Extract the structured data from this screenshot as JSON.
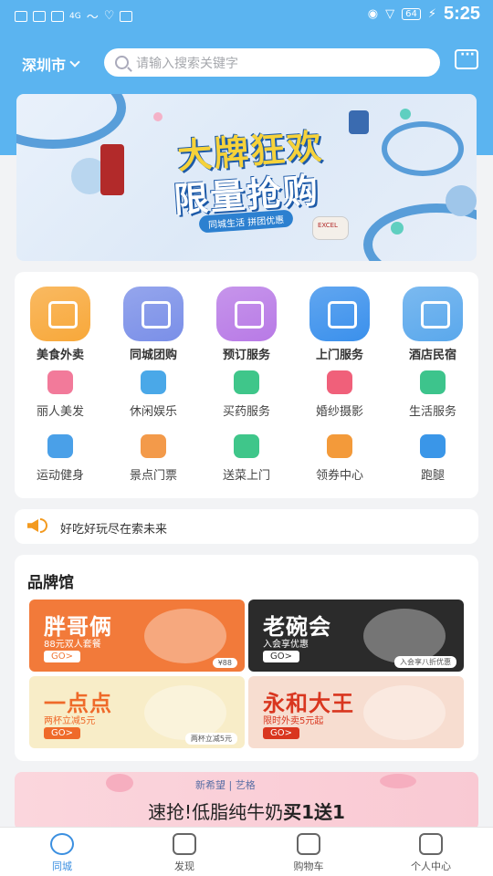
{
  "status_bar": {
    "time": "5:25",
    "battery": "64",
    "signal_label": "4G"
  },
  "header": {
    "city": "深圳市",
    "search_placeholder": "请输入搜索关键字",
    "message_icon": "message-icon"
  },
  "banner": {
    "title_line1": "大牌狂欢",
    "title_line2": "限量抢购",
    "subtitle": "同城生活 拼团优惠",
    "product_label": "EXCEL"
  },
  "services": {
    "primary": [
      {
        "label": "美食外卖",
        "icon": "food-icon",
        "color": "#f8a83a"
      },
      {
        "label": "同城团购",
        "icon": "basket-icon",
        "color": "#7a8fe8"
      },
      {
        "label": "预订服务",
        "icon": "calendar-icon",
        "color": "#b87ae6"
      },
      {
        "label": "上门服务",
        "icon": "door-icon",
        "color": "#3a90ec"
      },
      {
        "label": "酒店民宿",
        "icon": "hotel-icon",
        "color": "#5aa8ec"
      }
    ],
    "secondary": [
      {
        "label": "丽人美发",
        "icon": "beauty-icon",
        "color": "#f27a9a"
      },
      {
        "label": "休闲娱乐",
        "icon": "microphone-icon",
        "color": "#4aa8e8"
      },
      {
        "label": "买药服务",
        "icon": "medicine-icon",
        "color": "#3fc68a"
      },
      {
        "label": "婚纱摄影",
        "icon": "heart-camera-icon",
        "color": "#f0607a"
      },
      {
        "label": "生活服务",
        "icon": "house-icon",
        "color": "#3dc48c"
      },
      {
        "label": "运动健身",
        "icon": "dumbbell-icon",
        "color": "#4aa0e8"
      },
      {
        "label": "景点门票",
        "icon": "ticket-icon",
        "color": "#f39a4a"
      },
      {
        "label": "送菜上门",
        "icon": "delivery-truck-icon",
        "color": "#3fc68a"
      },
      {
        "label": "领券中心",
        "icon": "coupon-icon",
        "color": "#f39a3a"
      },
      {
        "label": "跑腿",
        "icon": "runner-icon",
        "color": "#3a96e8"
      }
    ]
  },
  "notice": {
    "text": "好吃好玩尽在索未来"
  },
  "brand": {
    "title": "品牌馆",
    "tiles": [
      {
        "name": "胖哥俩",
        "sub": "88元双人套餐",
        "go": "GO>",
        "tag": "¥88",
        "bg": "#f27a3a",
        "name_color": "#fff",
        "go_bg": "#fff",
        "go_color": "#f27a3a"
      },
      {
        "name": "老碗会",
        "sub": "入会享优惠",
        "go": "GO>",
        "tag": "入会享八折优惠",
        "bg": "#2b2b2b",
        "name_color": "#fff",
        "go_bg": "#fff",
        "go_color": "#333"
      },
      {
        "name": "一点点",
        "sub": "两杯立减5元",
        "go": "GO>",
        "tag": "两杯立减5元",
        "bg": "#f8edc8",
        "name_color": "#ef6a2a",
        "go_bg": "#ef6a2a",
        "go_color": "#fff"
      },
      {
        "name": "永和大王",
        "sub": "限时外卖5元起",
        "go": "GO>",
        "tag": "",
        "bg": "#f7ddd0",
        "name_color": "#d9361f",
        "go_bg": "#d9361f",
        "go_color": "#fff"
      }
    ]
  },
  "promo": {
    "brand": "新希望 | 艺格",
    "text_prefix": "速抢!低脂纯牛奶",
    "text_bold": "买1送1"
  },
  "bottom_nav": [
    {
      "label": "同城",
      "icon": "location-icon",
      "active": true
    },
    {
      "label": "发现",
      "icon": "planet-icon",
      "active": false
    },
    {
      "label": "购物车",
      "icon": "cart-icon",
      "active": false
    },
    {
      "label": "个人中心",
      "icon": "user-icon",
      "active": false
    }
  ]
}
